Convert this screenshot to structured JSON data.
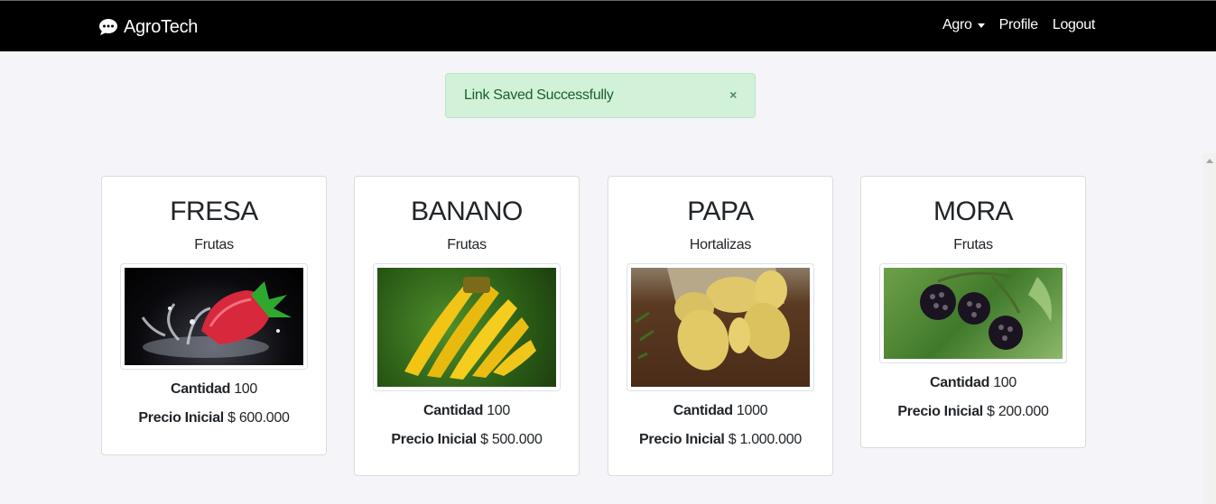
{
  "navbar": {
    "brand": "AgroTech",
    "menu_agro": "Agro",
    "menu_profile": "Profile",
    "menu_logout": "Logout"
  },
  "alert": {
    "message": "Link Saved Successfully",
    "close_glyph": "×"
  },
  "labels": {
    "cantidad": "Cantidad",
    "precio": "Precio Inicial"
  },
  "products": [
    {
      "name": "FRESA",
      "category": "Frutas",
      "quantity": "100",
      "price": "$ 600.000",
      "image": "strawberry-splash"
    },
    {
      "name": "BANANO",
      "category": "Frutas",
      "quantity": "100",
      "price": "$ 500.000",
      "image": "banana-bunch"
    },
    {
      "name": "PAPA",
      "category": "Hortalizas",
      "quantity": "1000",
      "price": "$ 1.000.000",
      "image": "potatoes-on-soil"
    },
    {
      "name": "MORA",
      "category": "Frutas",
      "quantity": "100",
      "price": "$ 200.000",
      "image": "blackberries"
    }
  ],
  "colors": {
    "navbar": "#000000",
    "alert_bg": "#d1f2d9",
    "alert_text": "#1b5e2c",
    "page_bg": "#f4f4f9"
  }
}
